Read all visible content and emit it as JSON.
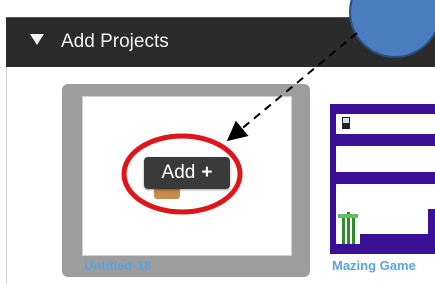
{
  "panel": {
    "title": "Add Projects"
  },
  "projects": [
    {
      "name": "Untitled-18",
      "selected": true
    },
    {
      "name": "Mazing Game",
      "selected": false
    }
  ],
  "add_button": {
    "label": "Add",
    "plus": "+"
  },
  "colors": {
    "header_bg": "#2b2b2b",
    "selected_card_bg": "#9d9d9d",
    "project_title": "#5aa3e3",
    "highlight_ring": "#e0151a",
    "callout_circle": "#4a7dbf",
    "maze_wall": "#3b0f96"
  },
  "icons": {
    "collapse": "caret-down-icon"
  }
}
